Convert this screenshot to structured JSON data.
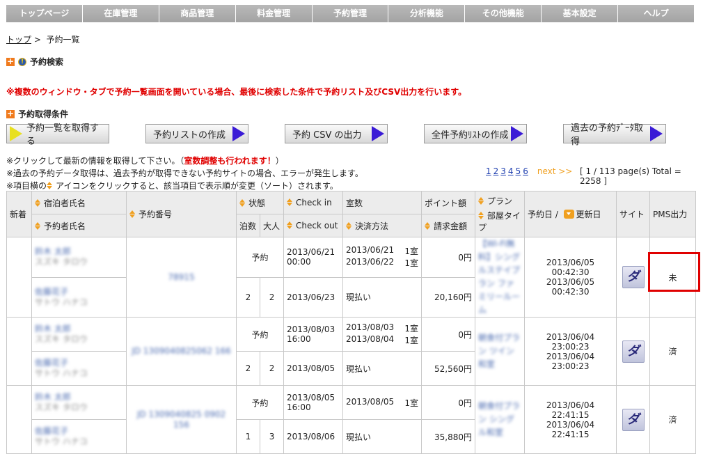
{
  "nav": [
    "トップページ",
    "在庫管理",
    "商品管理",
    "料金管理",
    "予約管理",
    "分析機能",
    "その他機能",
    "基本設定",
    "ヘルプ"
  ],
  "breadcrumb": {
    "home": "トップ",
    "sep": ">",
    "current": "予約一覧"
  },
  "search_title": "予約検索",
  "warning": "※複数のウィンドウ・タブで予約一覧画面を開いている場合、最後に検索した条件で予約リスト及びCSV出力を行います。",
  "conditions_title": "予約取得条件",
  "buttons": [
    "予約一覧を取得する",
    "予約リストの作成",
    "予約 CSV の出力",
    "全件予約ﾘｽﾄの作成",
    "過去の予約ﾃﾞｰﾀ取得"
  ],
  "notes": {
    "line1_a": "※クリックして最新の情報を取得して下さい。（",
    "line1_red": "室数調整も行われます！",
    "line1_b": "）",
    "line2": "※過去の予約データ取得は、過去予約が取得できない予約サイトの場合、エラーが発生します。",
    "line3_a": "※項目横の",
    "line3_b": "アイコンをクリックすると、該当項目で表示順が変更（ソート）されます。"
  },
  "pager": {
    "pages": [
      "1",
      "2",
      "3",
      "4",
      "5",
      "6"
    ],
    "next": "next >>",
    "info": "[ 1 / 113 page(s) Total = 2258 ]"
  },
  "headers": {
    "new": "新着",
    "guest": "宿泊者氏名",
    "booker": "予約者氏名",
    "resno": "予約番号",
    "status": "状態",
    "nights": "泊数",
    "adults": "大人",
    "checkin": "Check in",
    "checkout": "Check out",
    "rooms": "室数",
    "payment": "決済方法",
    "points": "ポイント額",
    "billing": "請求金額",
    "plan": "プラン",
    "roomtype": "部屋タイプ",
    "resdate": "予約日 /",
    "updated": "更新日",
    "site": "サイト",
    "pms": "PMS出力"
  },
  "rows": [
    {
      "guest_a": "鈴木 太郎",
      "guest_b": "スズキ タロウ",
      "booker_a": "佐藤花子",
      "booker_b": "サトウ ハナコ",
      "resno": "78915",
      "status": "予約",
      "nights": "2",
      "adults": "2",
      "checkin": "2013/06/21",
      "checkin_time": "00:00",
      "checkout": "2013/06/23",
      "date1": "2013/06/21",
      "room1": "1室",
      "date2": "2013/06/22",
      "room2": "1室",
      "payment": "現払い",
      "points": "0円",
      "billing": "20,160円",
      "plan": "【Wi-Fi無料】シングルステイプラン ファミリールーム",
      "resdate": "2013/06/05 00:42:30",
      "updated": "2013/06/05 00:42:30",
      "site": "ダ",
      "pms": "未"
    },
    {
      "guest_a": "鈴木 太郎",
      "guest_b": "スズキ タロウ",
      "booker_a": "佐藤花子",
      "booker_b": "サトウ ハナコ",
      "resno": "JD 1309040825062 166",
      "status": "予約",
      "nights": "2",
      "adults": "2",
      "checkin": "2013/08/03",
      "checkin_time": "16:00",
      "checkout": "2013/08/05",
      "date1": "2013/08/03",
      "room1": "1室",
      "date2": "2013/08/04",
      "room2": "1室",
      "payment": "現払い",
      "points": "0円",
      "billing": "52,560円",
      "plan": "朝食付プラン ツイン和室",
      "resdate": "2013/06/04 23:00:23",
      "updated": "2013/06/04 23:00:23",
      "site": "ダ",
      "pms": "済"
    },
    {
      "guest_a": "鈴木 太郎",
      "guest_b": "スズキ タロウ",
      "booker_a": "佐藤花子",
      "booker_b": "サトウ ハナコ",
      "resno": "JD 1309040825 0902 156",
      "status": "予約",
      "nights": "1",
      "adults": "3",
      "checkin": "2013/08/05",
      "checkin_time": "16:00",
      "checkout": "2013/08/06",
      "date1": "2013/08/05",
      "room1": "1室",
      "date2": "",
      "room2": "",
      "payment": "現払い",
      "points": "0円",
      "billing": "35,880円",
      "plan": "朝食付プラン シングル和室",
      "resdate": "2013/06/04 22:41:15",
      "updated": "2013/06/04 22:41:15",
      "site": "ダ",
      "pms": "済"
    }
  ]
}
